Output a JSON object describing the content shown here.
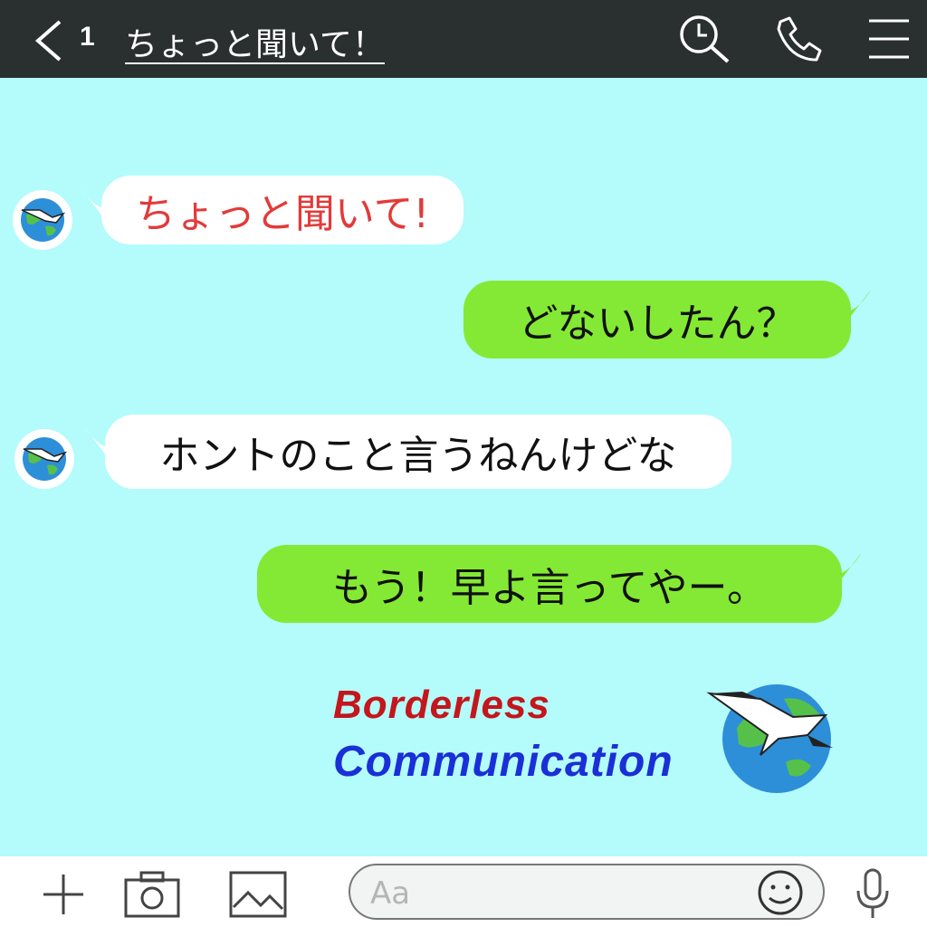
{
  "header": {
    "unread_count": "1",
    "title": "ちょっと聞いて！",
    "icons": [
      "back-chevron-icon",
      "search-icon",
      "phone-icon",
      "menu-icon"
    ],
    "background": "#2a2f30"
  },
  "chat": {
    "background": "#b4fbfb",
    "messages": [
      {
        "side": "incoming",
        "text": "ちょっと聞いて!",
        "color": "#e23a3a"
      },
      {
        "side": "outgoing",
        "text": "どないしたん？",
        "color": "#111111"
      },
      {
        "side": "incoming",
        "text": "ホントのこと言うねんけどな",
        "color": "#111111"
      },
      {
        "side": "outgoing",
        "text": "もう！早よ言ってやー。",
        "color": "#111111"
      }
    ],
    "bubble_colors": {
      "incoming": "#ffffff",
      "outgoing": "#84e934"
    }
  },
  "logo": {
    "line1": "Borderless",
    "line2": "Communication",
    "line1_color": "#c4161c",
    "line2_color": "#1a2fd6"
  },
  "input_bar": {
    "placeholder": "Aa",
    "icons": [
      "plus-icon",
      "camera-icon",
      "image-icon",
      "smiley-icon",
      "microphone-icon"
    ]
  }
}
